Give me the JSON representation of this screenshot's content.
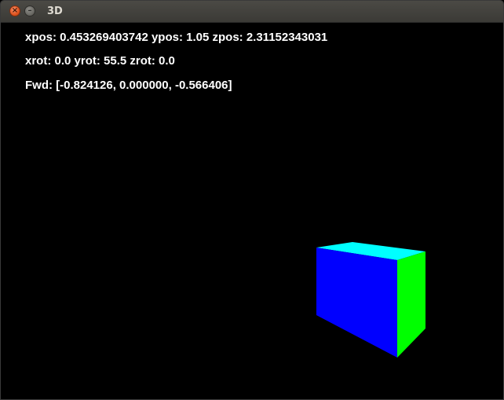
{
  "window": {
    "title": "3D",
    "close_glyph": "×",
    "minimize_glyph": "–"
  },
  "hud": {
    "position": "xpos: 0.453269403742 ypos: 1.05 zpos: 2.31152343031",
    "rotation": "xrot: 0.0 yrot: 55.5 zrot: 0.0",
    "forward": "Fwd: [-0.824126, 0.000000, -0.566406]"
  },
  "scene": {
    "background_color": "#000000",
    "cube_faces": {
      "front_color": "#0000ff",
      "top_color": "#00ffff",
      "side_color": "#00ff00"
    }
  }
}
